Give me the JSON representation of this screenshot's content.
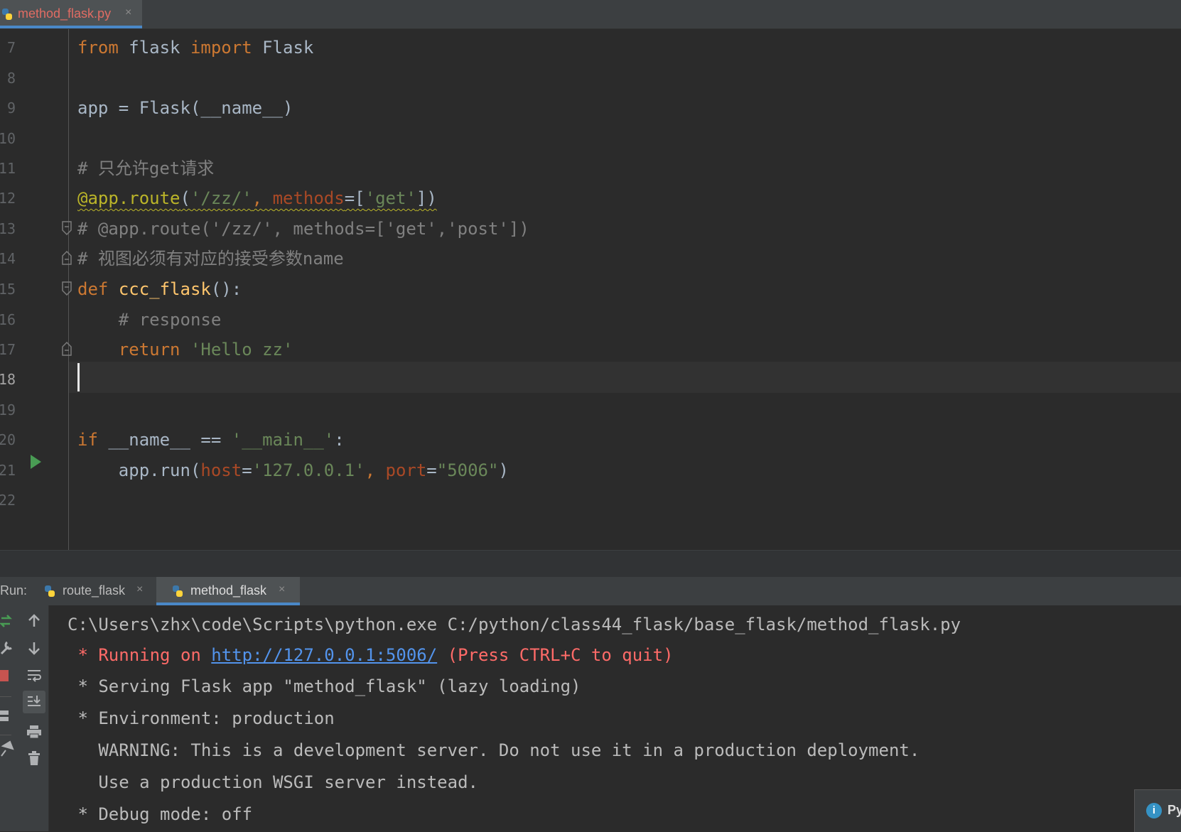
{
  "editor_tab": {
    "filename": "method_flask.py",
    "close": "×"
  },
  "editor": {
    "line_numbers": [
      "7",
      "8",
      "9",
      "10",
      "11",
      "12",
      "13",
      "14",
      "15",
      "16",
      "17",
      "18",
      "19",
      "20",
      "21",
      "22"
    ],
    "current_line_number": "18"
  },
  "run": {
    "label": "Run:",
    "tabs": [
      {
        "label": "route_flask",
        "close": "×",
        "active": false
      },
      {
        "label": "method_flask",
        "close": "×",
        "active": true
      }
    ]
  },
  "console": {
    "lines": [
      {
        "text": "C:\\Users\\zhx\\code\\Scripts\\python.exe C:/python/class44_flask/base_flask/method_flask.py"
      },
      {
        "prefix": " * Running on ",
        "link": "http://127.0.0.1:5006/",
        "suffix": " (Press CTRL+C to quit)"
      },
      {
        "text": " * Serving Flask app \"method_flask\" (lazy loading)"
      },
      {
        "text": " * Environment: production"
      },
      {
        "text": "   WARNING: This is a development server. Do not use it in a production deployment."
      },
      {
        "text": "   Use a production WSGI server instead."
      },
      {
        "text": " * Debug mode: off"
      }
    ]
  },
  "notification": {
    "text": "Py"
  },
  "colors": {
    "keyword": "#cc7832",
    "function": "#ffc66d",
    "string": "#6a8759",
    "comment": "#808080",
    "decorator": "#bbb529",
    "param": "#aa4926",
    "error_text": "#ff6b68",
    "link": "#5394ec",
    "accent": "#4a88c7"
  }
}
